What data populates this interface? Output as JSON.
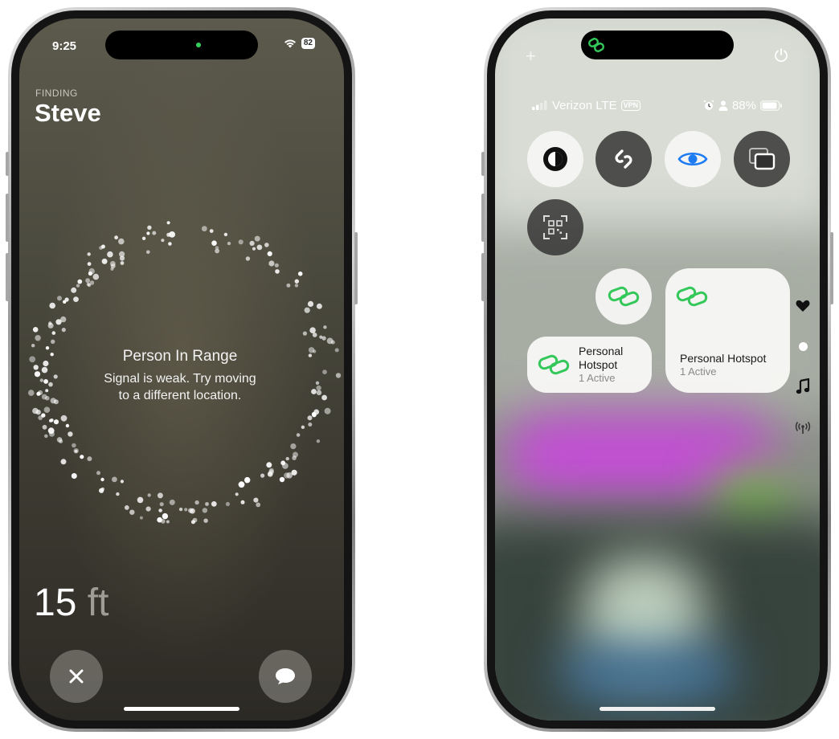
{
  "left_phone": {
    "status_bar": {
      "time": "9:25",
      "battery": "82"
    },
    "finding_label": "FINDING",
    "person_name": "Steve",
    "status_title": "Person In Range",
    "status_message_line1": "Signal is weak. Try moving",
    "status_message_line2": "to a different location.",
    "distance_value": "15",
    "distance_unit": "ft",
    "icons": {
      "close": "close-icon",
      "message": "message-bubble-icon",
      "wifi": "wifi-icon"
    }
  },
  "right_phone": {
    "carrier": "Verizon LTE",
    "vpn": "VPN",
    "battery_percent": "88%",
    "hotspot_small": {
      "name_line1": "Personal",
      "name_line2": "Hotspot",
      "status": "1 Active"
    },
    "hotspot_large": {
      "name": "Personal Hotspot",
      "status": "1 Active"
    },
    "colors": {
      "hotspot_green": "#34c759",
      "accent_blue": "#1e7cf2"
    },
    "icons": {
      "top_left": "plus-icon",
      "top_right": "power-icon",
      "controls": [
        "dark-mode-icon",
        "shazam-icon",
        "eye-icon",
        "screen-mirroring-icon",
        "code-scanner-icon",
        "hotspot-link-icon"
      ],
      "side": [
        "heart-icon",
        "dot-icon",
        "music-note-icon",
        "antenna-icon"
      ]
    }
  }
}
